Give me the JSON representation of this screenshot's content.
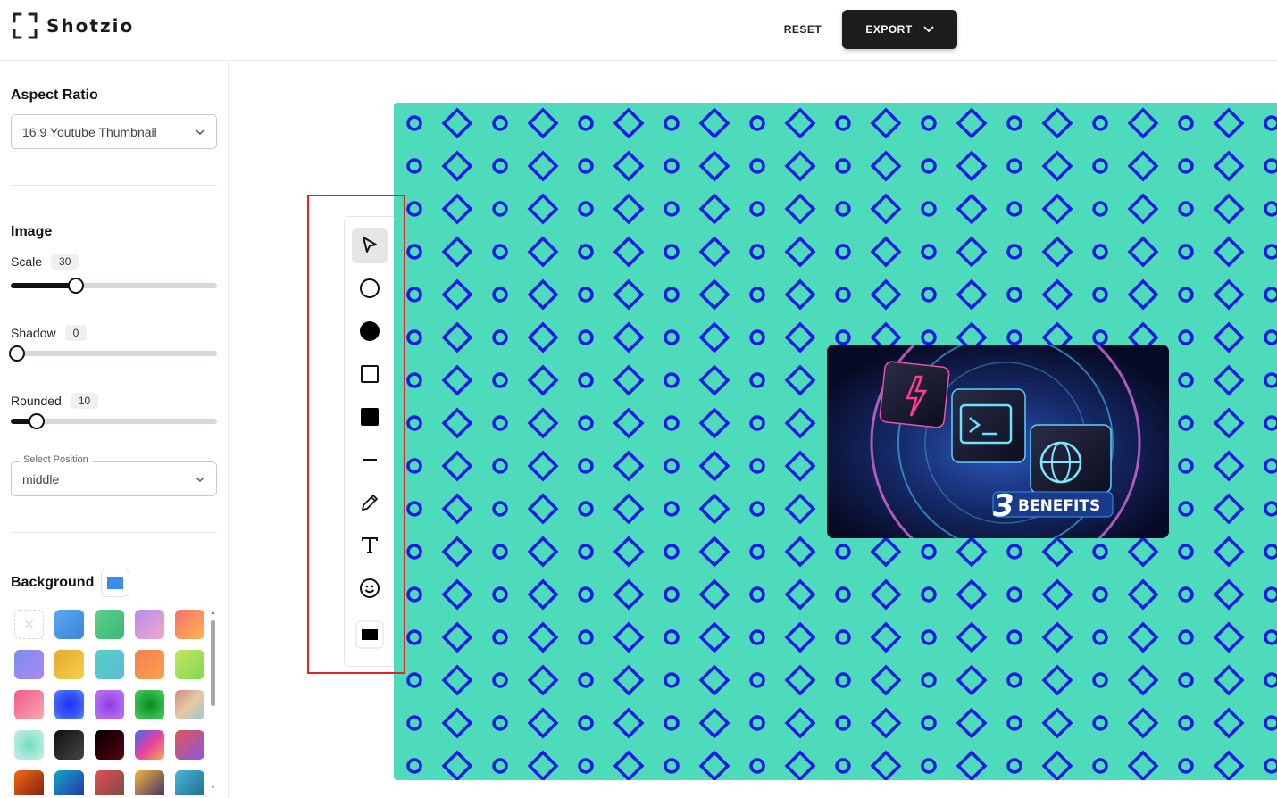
{
  "app": {
    "name": "Shotzio",
    "logo_icon": "frame-corners-icon"
  },
  "header": {
    "reset_label": "RESET",
    "export_label": "EXPORT"
  },
  "sidebar": {
    "aspect_ratio": {
      "title": "Aspect Ratio",
      "selected": "16:9 Youtube Thumbnail"
    },
    "image": {
      "title": "Image",
      "scale": {
        "label": "Scale",
        "value": 30,
        "fraction": 0.315
      },
      "shadow": {
        "label": "Shadow",
        "value": 0,
        "fraction": 0.0
      },
      "rounded": {
        "label": "Rounded",
        "value": 10,
        "fraction": 0.125
      },
      "position": {
        "label": "Select Position",
        "selected": "middle"
      }
    },
    "background": {
      "title": "Background",
      "current_color": "#3a8ee6",
      "swatches": [
        "none",
        "linear-gradient(135deg,#5aa8ef,#3a86dd)",
        "linear-gradient(135deg,#5fcf8a,#3ab878)",
        "linear-gradient(135deg,#b58bf0,#f2a8c5)",
        "linear-gradient(135deg,#f76f6f,#f9b74d)",
        "linear-gradient(135deg,#7d8ef0,#a888f0)",
        "linear-gradient(135deg,#e6a92f,#f3d04a)",
        "linear-gradient(135deg,#4fd1c5,#62b9d6)",
        "linear-gradient(135deg,#f57f52,#fca04c)",
        "linear-gradient(135deg,#c9e45c,#7ed957)",
        "linear-gradient(135deg,#f05b8d,#f9a7b0)",
        "radial-gradient(circle,#1e30ff,#3a5cf0 60%,#5f8fff)",
        "radial-gradient(circle,#8a3de0,#b468f0 70%)",
        "radial-gradient(circle,#0a8a1f,#39c454 80%)",
        "linear-gradient(135deg,#c98a8a,#e8c9a0,#9ec7d8)",
        "radial-gradient(circle,#6fe0c0,#b9ece0 80%)",
        "linear-gradient(135deg,#111,#444)",
        "linear-gradient(135deg,#000,#5a0010)",
        "linear-gradient(135deg,#3b6ff5,#e63fa0,#f5a94d)",
        "linear-gradient(135deg,#e05555,#8a5ae0)",
        "linear-gradient(135deg,#f26a1b,#7a1e08)",
        "linear-gradient(135deg,#11a5c9,#2a2fa8)",
        "linear-gradient(135deg,#e05050,#7a4a4a)",
        "linear-gradient(135deg,#f5b342,#3a2a6a)",
        "linear-gradient(135deg,#4cb5d9,#1c6a8a)"
      ]
    }
  },
  "toolbar": {
    "tools": [
      {
        "name": "select-tool",
        "icon": "cursor-arrow-icon",
        "active": true
      },
      {
        "name": "circle-outline-tool",
        "icon": "circle-outline-icon",
        "active": false
      },
      {
        "name": "circle-filled-tool",
        "icon": "circle-filled-icon",
        "active": false
      },
      {
        "name": "square-outline-tool",
        "icon": "square-outline-icon",
        "active": false
      },
      {
        "name": "square-filled-tool",
        "icon": "square-filled-icon",
        "active": false
      },
      {
        "name": "line-tool",
        "icon": "line-icon",
        "active": false
      },
      {
        "name": "pencil-tool",
        "icon": "pencil-icon",
        "active": false
      },
      {
        "name": "text-tool",
        "icon": "text-icon",
        "active": false
      },
      {
        "name": "emoji-tool",
        "icon": "smiley-icon",
        "active": false
      },
      {
        "name": "color-picker-tool",
        "icon": "color-swatch-icon",
        "active": false
      }
    ]
  },
  "canvas": {
    "background": {
      "base_color": "#4ddbbc",
      "pattern_color": "#1a1ae6"
    },
    "thumbnail": {
      "number": "3",
      "label": "BENEFITS"
    }
  },
  "highlight": {
    "color": "#e02424"
  }
}
